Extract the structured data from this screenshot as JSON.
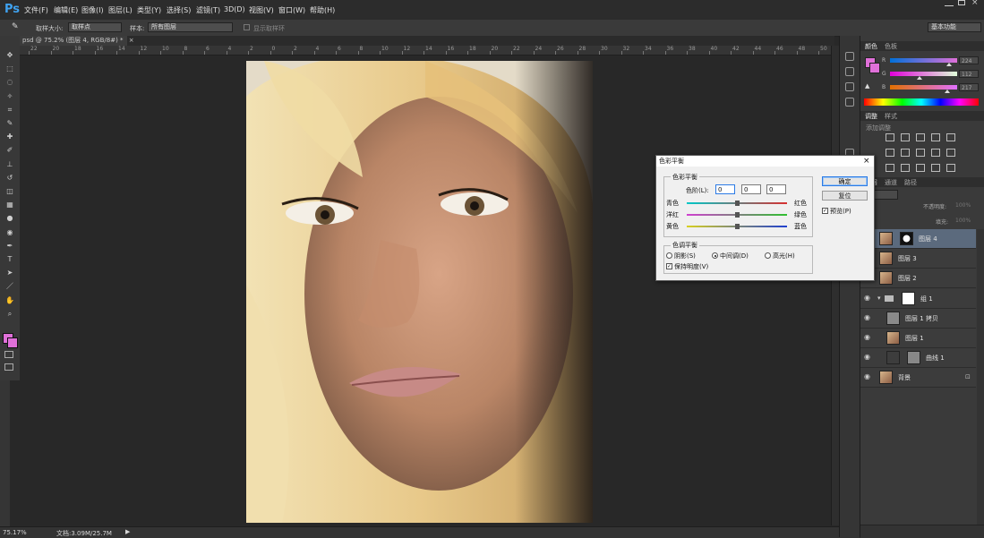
{
  "app": {
    "logo": "Ps"
  },
  "menu": [
    "文件(F)",
    "编辑(E)",
    "图像(I)",
    "图层(L)",
    "类型(Y)",
    "选择(S)",
    "滤镜(T)",
    "3D(D)",
    "视图(V)",
    "窗口(W)",
    "帮助(H)"
  ],
  "options_bar": {
    "sample_size_label": "取样大小:",
    "sample_size_value": "取样点",
    "sample_label": "样本:",
    "sample_value": "所有图层",
    "show_ring_label": "显示取样环",
    "workspace": "基本功能"
  },
  "document": {
    "tab_title": "psd @ 75.2% (图层 4, RGB/8#) *",
    "ruler_marks": [
      "22",
      "20",
      "18",
      "16",
      "14",
      "12",
      "10",
      "8",
      "6",
      "4",
      "2",
      "0",
      "2",
      "4",
      "6",
      "8",
      "10",
      "12",
      "14",
      "16",
      "18",
      "20",
      "22",
      "24",
      "26",
      "28",
      "30",
      "32",
      "34",
      "36",
      "38",
      "40",
      "42",
      "44",
      "46",
      "48",
      "50"
    ]
  },
  "status": {
    "zoom": "75.17%",
    "doc_size": "文档:3.09M/25.7M"
  },
  "color_panel": {
    "tabs": [
      "颜色",
      "色板"
    ],
    "channels": [
      {
        "label": "R",
        "value": "224",
        "gradient": "linear-gradient(90deg,#0070d9,#e070d9)",
        "pos": 0.88
      },
      {
        "label": "G",
        "value": "112",
        "gradient": "linear-gradient(90deg,#e000d9,#e0ffd9)",
        "pos": 0.44
      },
      {
        "label": "B",
        "value": "217",
        "gradient": "linear-gradient(90deg,#e07000,#e070ff)",
        "pos": 0.85
      }
    ],
    "foreground": "#e070d9"
  },
  "adjustments_panel": {
    "tabs": [
      "调整",
      "样式"
    ],
    "subtitle": "添加调整"
  },
  "layers_panel": {
    "tabs": [
      "图层",
      "通道",
      "路径"
    ],
    "opacity_label": "不透明度:",
    "opacity_value": "100%",
    "fill_label": "填充:",
    "fill_value": "100%",
    "layers": [
      {
        "name": "图层 4",
        "selected": true,
        "thumb": "face",
        "mask": true,
        "indent": 0
      },
      {
        "name": "图层 3",
        "selected": false,
        "thumb": "face",
        "mask": false,
        "indent": 0
      },
      {
        "name": "图层 2",
        "selected": false,
        "thumb": "face",
        "mask": false,
        "indent": 0
      },
      {
        "name": "组 1",
        "selected": false,
        "thumb": "folder",
        "mask": true,
        "indent": 0
      },
      {
        "name": "图层 1 拷贝",
        "selected": false,
        "thumb": "gray",
        "mask": false,
        "indent": 1
      },
      {
        "name": "图层 1",
        "selected": false,
        "thumb": "face",
        "mask": false,
        "indent": 1
      },
      {
        "name": "曲线 1",
        "selected": false,
        "thumb": "curves",
        "mask": true,
        "indent": 1
      },
      {
        "name": "背景",
        "selected": false,
        "thumb": "face",
        "mask": false,
        "indent": 0,
        "locked": true
      }
    ]
  },
  "dialog": {
    "title": "色彩平衡",
    "group1": "色彩平衡",
    "levels_label": "色阶(L):",
    "levels": [
      "0",
      "0",
      "0"
    ],
    "sliders": [
      {
        "left": "青色",
        "right": "红色",
        "gradient": "linear-gradient(90deg,#00c8c8,#d83030)"
      },
      {
        "left": "洋红",
        "right": "绿色",
        "gradient": "linear-gradient(90deg,#d040d0,#30c030)"
      },
      {
        "left": "黄色",
        "right": "蓝色",
        "gradient": "linear-gradient(90deg,#d8d020,#2040d0)"
      }
    ],
    "group2": "色调平衡",
    "shadows": "阴影(S)",
    "midtones": "中间调(D)",
    "highlights": "高光(H)",
    "preserve": "保持明度(V)",
    "ok": "确定",
    "reset": "复位",
    "preview": "预览(P)"
  }
}
